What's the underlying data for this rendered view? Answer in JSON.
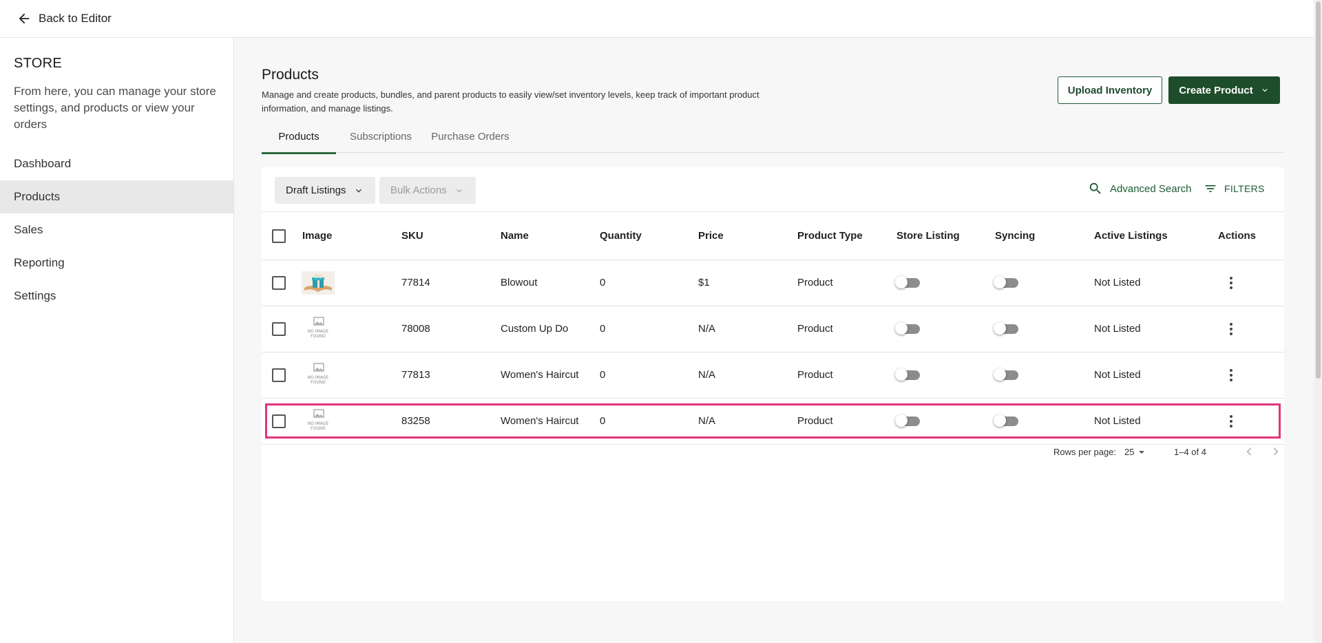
{
  "topbar": {
    "back_label": "Back to Editor"
  },
  "sidebar": {
    "title": "STORE",
    "description": "From here, you can manage your store settings, and products or view your orders",
    "items": [
      {
        "label": "Dashboard",
        "active": false
      },
      {
        "label": "Products",
        "active": true
      },
      {
        "label": "Sales",
        "active": false
      },
      {
        "label": "Reporting",
        "active": false
      },
      {
        "label": "Settings",
        "active": false
      }
    ]
  },
  "header": {
    "title": "Products",
    "description": "Manage and create products, bundles, and parent products to easily view/set inventory levels, keep track of important product information, and manage listings.",
    "upload_label": "Upload Inventory",
    "create_label": "Create Product"
  },
  "tabs": [
    {
      "label": "Products",
      "active": true
    },
    {
      "label": "Subscriptions",
      "active": false
    },
    {
      "label": "Purchase Orders",
      "active": false
    }
  ],
  "toolbar": {
    "listing_filter": "Draft Listings",
    "bulk_actions": "Bulk Actions",
    "advanced_search": "Advanced Search",
    "filters": "FILTERS"
  },
  "table": {
    "columns": [
      "Image",
      "SKU",
      "Name",
      "Quantity",
      "Price",
      "Product Type",
      "Store Listing",
      "Syncing",
      "Active Listings",
      "Actions"
    ],
    "rows": [
      {
        "image": "gift-box-photo",
        "sku": "77814",
        "name": "Blowout",
        "quantity": "0",
        "price": "$1",
        "type": "Product",
        "store_listing": false,
        "syncing": false,
        "active_listings": "Not Listed"
      },
      {
        "image": "no-image-found",
        "sku": "78008",
        "name": "Custom Up Do",
        "quantity": "0",
        "price": "N/A",
        "type": "Product",
        "store_listing": false,
        "syncing": false,
        "active_listings": "Not Listed"
      },
      {
        "image": "no-image-found",
        "sku": "77813",
        "name": "Women's Haircut",
        "quantity": "0",
        "price": "N/A",
        "type": "Product",
        "store_listing": false,
        "syncing": false,
        "active_listings": "Not Listed"
      },
      {
        "image": "no-image-found",
        "sku": "83258",
        "name": "Women's Haircut",
        "quantity": "0",
        "price": "N/A",
        "type": "Product",
        "store_listing": false,
        "syncing": false,
        "active_listings": "Not Listed"
      }
    ],
    "no_image_text": [
      "NO IMAGE",
      "FOUND"
    ]
  },
  "pagination": {
    "rows_per_page_label": "Rows per page:",
    "rows_per_page": "25",
    "range": "1–4 of 4"
  },
  "colors": {
    "brand_green": "#1e4d2b",
    "highlight": "#e0337a",
    "toggle_off": "#8c8c8c"
  }
}
